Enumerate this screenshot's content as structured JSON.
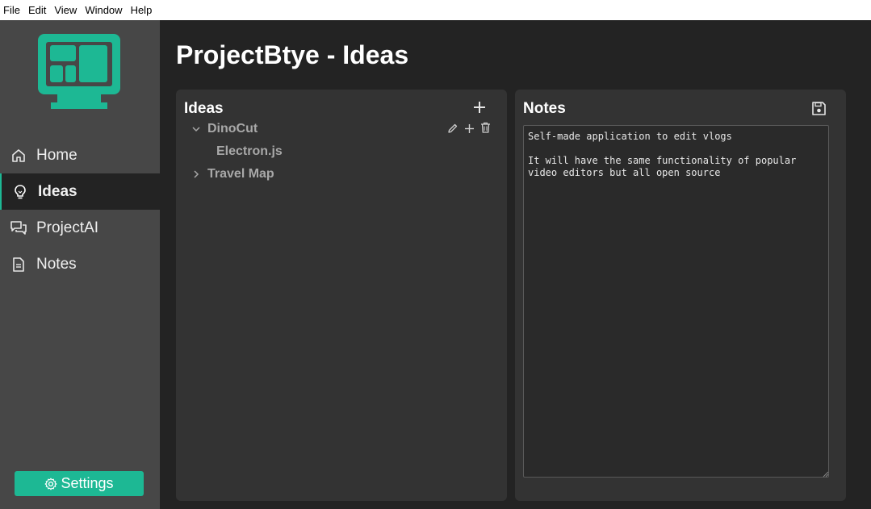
{
  "menu": [
    "File",
    "Edit",
    "View",
    "Window",
    "Help"
  ],
  "sidebar": {
    "items": [
      {
        "label": "Home",
        "icon": "home-icon",
        "active": false
      },
      {
        "label": "Ideas",
        "icon": "lightbulb-icon",
        "active": true
      },
      {
        "label": "ProjectAI",
        "icon": "chat-icon",
        "active": false
      },
      {
        "label": "Notes",
        "icon": "document-icon",
        "active": false
      }
    ],
    "settings_label": "Settings"
  },
  "page": {
    "title": "ProjectBtye - Ideas"
  },
  "ideas": {
    "title": "Ideas",
    "tree": [
      {
        "label": "DinoCut",
        "expanded": true,
        "children": [
          {
            "label": "Electron.js"
          }
        ]
      },
      {
        "label": "Travel Map",
        "expanded": false,
        "children": []
      }
    ]
  },
  "notes": {
    "title": "Notes",
    "content": "Self-made application to edit vlogs\n\nIt will have the same functionality of popular\nvideo editors but all open source"
  },
  "colors": {
    "accent": "#1db894",
    "sidebar_bg": "#474747",
    "main_bg": "#232323",
    "panel_bg": "#333333"
  }
}
